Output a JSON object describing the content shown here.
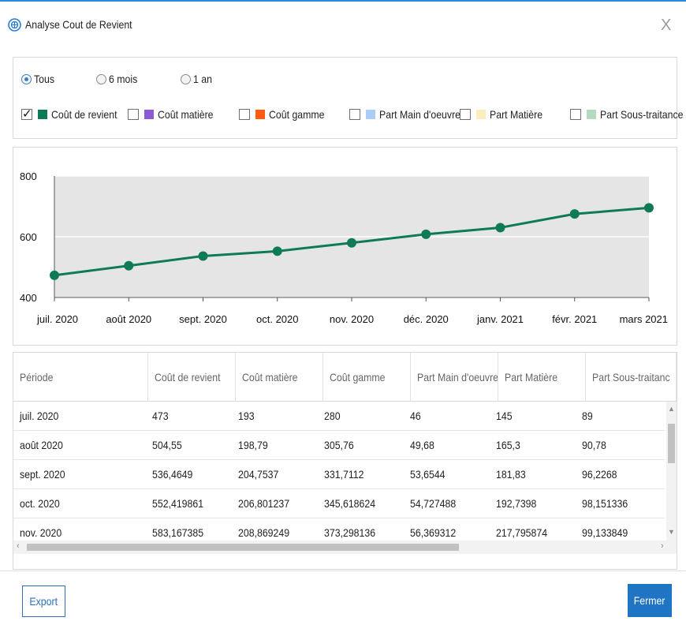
{
  "window": {
    "title": "Analyse Cout de Revient",
    "close_glyph": "X",
    "app_icon": "globe-icon"
  },
  "range": {
    "options": [
      {
        "label": "Tous",
        "selected": true
      },
      {
        "label": "6 mois",
        "selected": false
      },
      {
        "label": "1 an",
        "selected": false
      }
    ]
  },
  "series_toggles": [
    {
      "label": "Coût de revient",
      "checked": true,
      "color": "#0f7b55"
    },
    {
      "label": "Coût matière",
      "checked": false,
      "color": "#8b5bd6"
    },
    {
      "label": "Coût gamme",
      "checked": false,
      "color": "#ff5a10"
    },
    {
      "label": "Part Main d'oeuvre",
      "checked": false,
      "color": "#a9cdf4"
    },
    {
      "label": "Part Matière",
      "checked": false,
      "color": "#fbeebd"
    },
    {
      "label": "Part Sous-traitance",
      "checked": false,
      "color": "#b4dbbf"
    }
  ],
  "chart_data": {
    "type": "line",
    "x": [
      "juil. 2020",
      "août 2020",
      "sept. 2020",
      "oct. 2020",
      "nov. 2020",
      "déc. 2020",
      "janv. 2021",
      "févr. 2021",
      "mars 2021"
    ],
    "series": [
      {
        "name": "Coût de revient",
        "values": [
          473,
          504.55,
          536.4649,
          552.419861,
          580,
          608,
          630,
          675,
          695
        ],
        "color": "#0f7b55"
      }
    ],
    "ylim": [
      400,
      800
    ],
    "yticks": [
      "400",
      "600",
      "800"
    ],
    "grid": true,
    "plot_background": "#e5e5e5"
  },
  "table": {
    "columns": [
      "Période",
      "Coût de revient",
      "Coût matière",
      "Coût gamme",
      "Part Main d'oeuvre",
      "Part Matière",
      "Part Sous-traitanc"
    ],
    "rows": [
      [
        "juil. 2020",
        "473",
        "193",
        "280",
        "46",
        "145",
        "89"
      ],
      [
        "août 2020",
        "504,55",
        "198,79",
        "305,76",
        "49,68",
        "165,3",
        "90,78"
      ],
      [
        "sept. 2020",
        "536,4649",
        "204,7537",
        "331,7112",
        "53,6544",
        "181,83",
        "96,2268"
      ],
      [
        "oct. 2020",
        "552,419861",
        "206,801237",
        "345,618624",
        "54,727488",
        "192,7398",
        "98,151336"
      ],
      [
        "nov. 2020",
        "583,167385",
        "208,869249",
        "373,298136",
        "56,369312",
        "217,795874",
        "99,133849"
      ]
    ]
  },
  "footer": {
    "export_label": "Export",
    "close_label": "Fermer"
  }
}
